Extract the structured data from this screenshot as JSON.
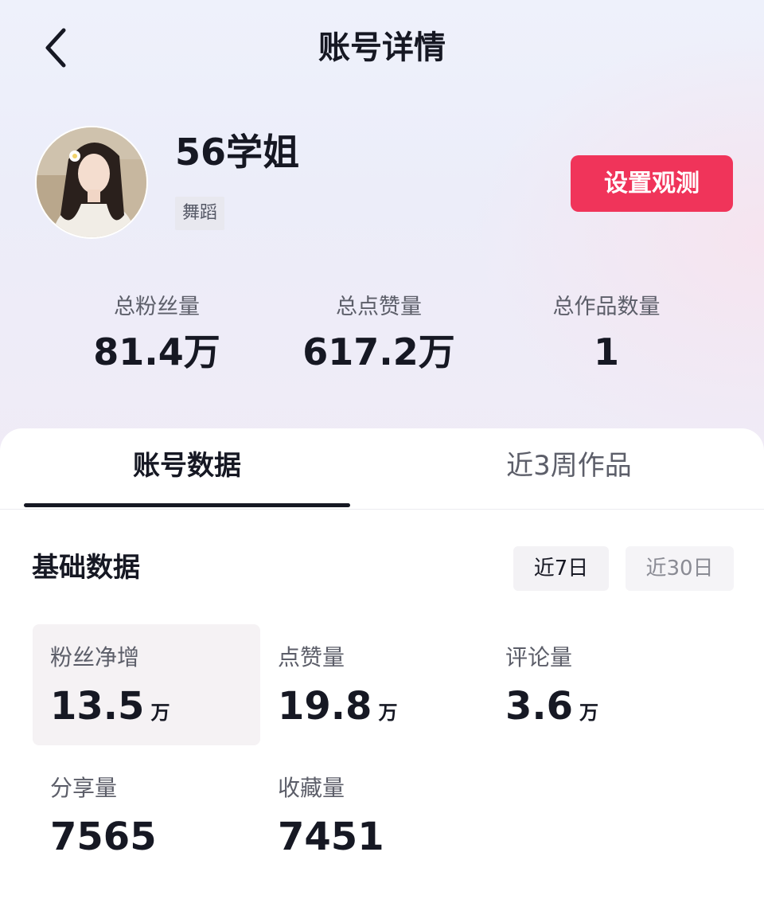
{
  "header": {
    "title": "账号详情"
  },
  "profile": {
    "name": "56学姐",
    "tag": "舞蹈",
    "action_label": "设置观测"
  },
  "totals": [
    {
      "label": "总粉丝量",
      "value": "81.4万"
    },
    {
      "label": "总点赞量",
      "value": "617.2万"
    },
    {
      "label": "总作品数量",
      "value": "1"
    }
  ],
  "tabs": [
    {
      "label": "账号数据",
      "active": true
    },
    {
      "label": "近3周作品",
      "active": false
    }
  ],
  "basic": {
    "title": "基础数据",
    "ranges": [
      {
        "label": "近7日",
        "selected": true
      },
      {
        "label": "近30日",
        "selected": false
      }
    ],
    "metrics": [
      {
        "label": "粉丝净增",
        "value": "13.5",
        "unit": "万"
      },
      {
        "label": "点赞量",
        "value": "19.8",
        "unit": "万"
      },
      {
        "label": "评论量",
        "value": "3.6",
        "unit": "万"
      },
      {
        "label": "分享量",
        "value": "7565",
        "unit": ""
      },
      {
        "label": "收藏量",
        "value": "7451",
        "unit": ""
      }
    ]
  },
  "colors": {
    "accent": "#f0345a",
    "text": "#161823",
    "secondary": "#5c5e69"
  },
  "icons": {
    "back": "chevron-left-icon"
  }
}
